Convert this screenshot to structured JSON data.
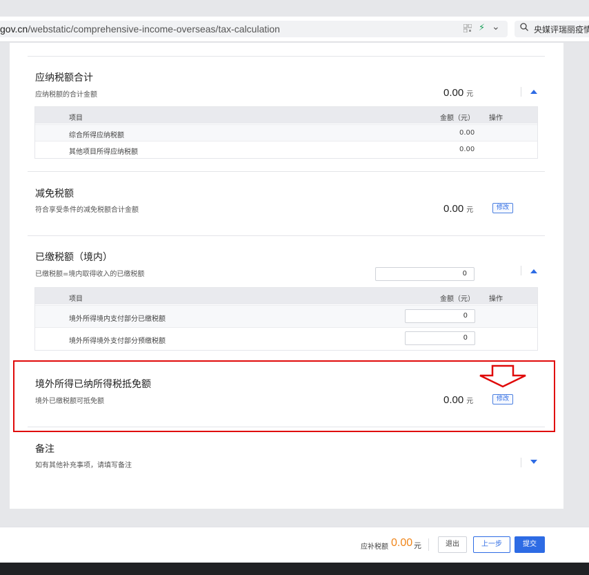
{
  "browser": {
    "url_host": "gov.cn",
    "url_path": "/webstatic/comprehensive-income-overseas/tax-calculation",
    "search_text": "央媒评瑞丽疫情"
  },
  "sections": {
    "payable": {
      "title": "应纳税额合计",
      "subtitle": "应纳税额的合计金额",
      "amount": "0.00",
      "unit": "元",
      "table": {
        "headers": [
          "项目",
          "金额（元）",
          "操作"
        ],
        "rows": [
          {
            "item": "综合所得应纳税额",
            "amount": "0.00"
          },
          {
            "item": "其他项目所得应纳税额",
            "amount": "0.00"
          }
        ]
      }
    },
    "reduction": {
      "title": "减免税额",
      "subtitle": "符合享受条件的减免税额合计金额",
      "amount": "0.00",
      "unit": "元",
      "action": "修改"
    },
    "paid": {
      "title": "已缴税额（境内）",
      "subtitle": "已缴税额=境内取得收入的已缴税额",
      "input_value": "0",
      "table": {
        "headers": [
          "项目",
          "金额（元）",
          "操作"
        ],
        "rows": [
          {
            "item": "境外所得境内支付部分已缴税额",
            "value": "0"
          },
          {
            "item": "境外所得境外支付部分预缴税额",
            "value": "0"
          }
        ]
      }
    },
    "foreign_credit": {
      "title": "境外所得已纳所得税抵免额",
      "subtitle": "境外已缴税额可抵免额",
      "amount": "0.00",
      "unit": "元",
      "action": "修改"
    },
    "remarks": {
      "title": "备注",
      "subtitle": "如有其他补充事项，请填写备注"
    }
  },
  "footer": {
    "label": "应补税额",
    "amount": "0.00",
    "unit": "元",
    "buttons": {
      "exit": "退出",
      "prev": "上一步",
      "submit": "提交"
    }
  },
  "colors": {
    "accent": "#2d6be4",
    "highlight_box": "#e00a0a",
    "footer_amount": "#f08519"
  }
}
